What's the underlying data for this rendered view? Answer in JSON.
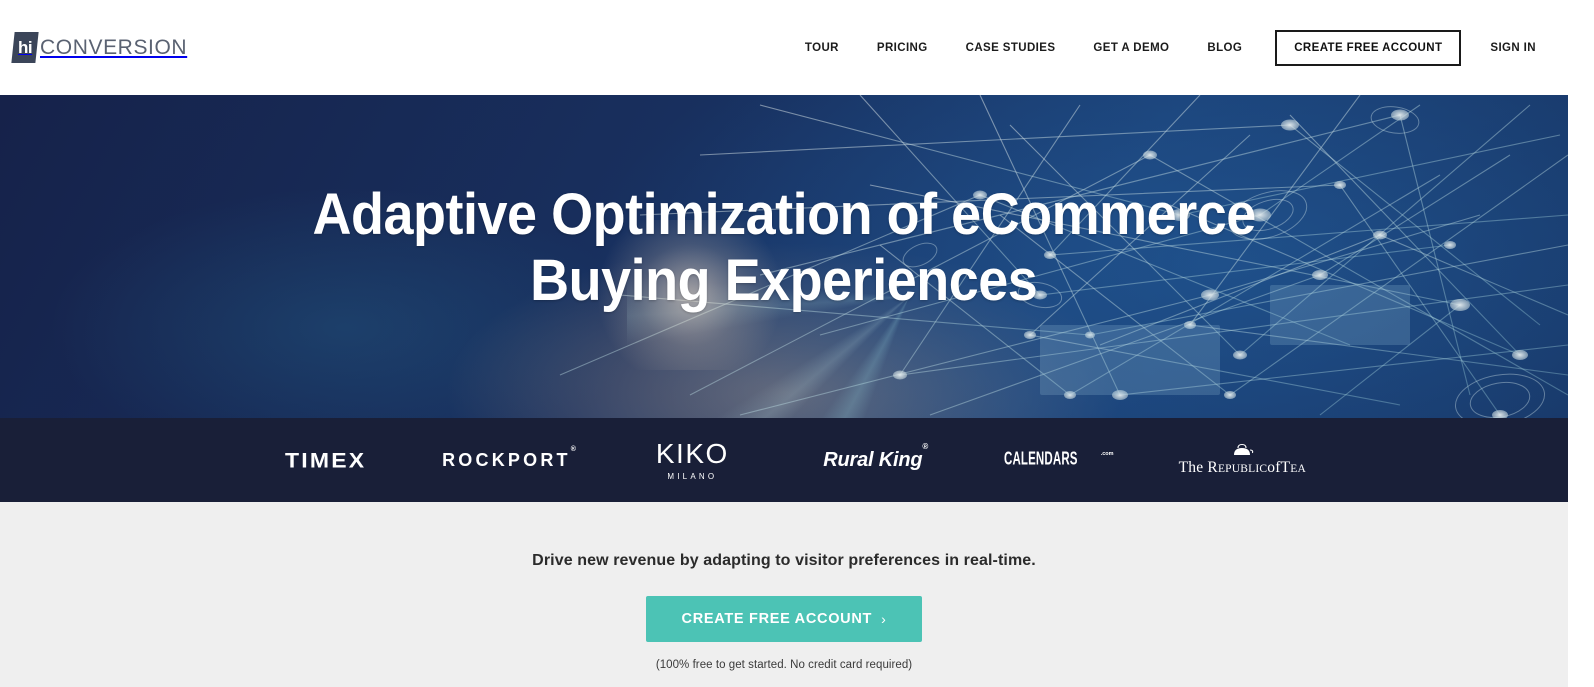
{
  "brand": {
    "logo_badge": "hi",
    "logo_word": "CONVERSION",
    "badge_color": "#3b4559",
    "word_color": "#5a6272"
  },
  "nav": {
    "items": [
      {
        "label": "TOUR",
        "name": "tour"
      },
      {
        "label": "PRICING",
        "name": "pricing"
      },
      {
        "label": "CASE STUDIES",
        "name": "case-studies"
      },
      {
        "label": "GET A DEMO",
        "name": "get-a-demo"
      },
      {
        "label": "BLOG",
        "name": "blog"
      }
    ],
    "cta_label": "CREATE FREE ACCOUNT",
    "signin_label": "SIGN IN"
  },
  "hero": {
    "headline_line1": "Adaptive Optimization of eCommerce",
    "headline_line2": "Buying Experiences",
    "background_colors": [
      "#16224a",
      "#18305f",
      "#1b3f74"
    ],
    "text_color": "#ffffff"
  },
  "logo_strip": {
    "background": "#191f38",
    "brands": [
      {
        "name": "timex",
        "label": "TIMEX"
      },
      {
        "name": "rockport",
        "label": "ROCKPORT",
        "mark": "®"
      },
      {
        "name": "kiko-milano",
        "label": "KIKO",
        "sub": "MILANO"
      },
      {
        "name": "rural-king",
        "label": "Rural King",
        "mark": "®"
      },
      {
        "name": "calendars-com",
        "label": "CALENDARS",
        "sub": ".com"
      },
      {
        "name": "republic-of-tea",
        "label": "The R",
        "label_rest": "EPUBLIC",
        "label_of": "of",
        "label_tea": "T",
        "label_tea_rest": "EA"
      }
    ]
  },
  "cta": {
    "headline": "Drive new revenue by adapting to visitor preferences in real-time.",
    "button_label": "CREATE FREE ACCOUNT",
    "button_chevron": "›",
    "button_color": "#4cc3b5",
    "fine_print": "(100% free to get started. No credit card required)",
    "background": "#efefef"
  }
}
